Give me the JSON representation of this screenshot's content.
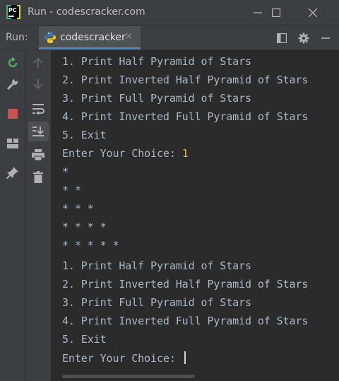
{
  "window": {
    "title": "Run - codescracker.com",
    "logo_text": "PC"
  },
  "run_panel": {
    "label": "Run:",
    "tab": {
      "label": "codescracker",
      "close_glyph": "×"
    }
  },
  "console": {
    "lines": [
      "1. Print Half Pyramid of Stars",
      "2. Print Inverted Half Pyramid of Stars",
      "3. Print Full Pyramid of Stars",
      "4. Print Inverted Full Pyramid of Stars",
      "5. Exit",
      "Enter Your Choice: ",
      "*",
      "* *",
      "* * *",
      "* * * *",
      "* * * * *",
      "1. Print Half Pyramid of Stars",
      "2. Print Inverted Half Pyramid of Stars",
      "3. Print Full Pyramid of Stars",
      "4. Print Inverted Full Pyramid of Stars",
      "5. Exit",
      "Enter Your Choice: "
    ],
    "user_input": "1"
  },
  "colors": {
    "background": "#2b2b2b",
    "chrome": "#3c3f41",
    "text": "#a9b7c6",
    "input": "#d7ba25",
    "accent": "#4a88c7"
  },
  "icons": {
    "titlebar": [
      "pycharm-logo-icon",
      "minimize-icon",
      "maximize-icon",
      "close-icon"
    ],
    "runbar": [
      "python-file-icon",
      "layout-icon",
      "gear-icon",
      "minimize-panel-icon"
    ],
    "left_toolbar": [
      "rerun-icon",
      "wrench-icon",
      "stop-icon",
      "layout-icon",
      "pin-icon"
    ],
    "second_toolbar": [
      "up-arrow-icon",
      "down-arrow-icon",
      "soft-wrap-icon",
      "scroll-to-end-icon",
      "print-icon",
      "trash-icon"
    ]
  }
}
